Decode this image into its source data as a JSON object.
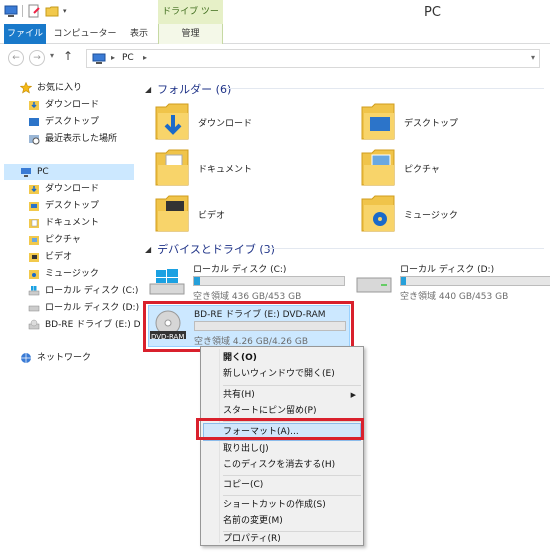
{
  "window": {
    "title": "PC",
    "context_tab_group": "ドライブ ツール"
  },
  "ribbon": {
    "tabs": [
      "ファイル",
      "コンピューター",
      "表示",
      "管理"
    ]
  },
  "address": {
    "path": "PC"
  },
  "navpane": {
    "favorites_label": "お気に入り",
    "favorites": [
      "ダウンロード",
      "デスクトップ",
      "最近表示した場所"
    ],
    "pc_label": "PC",
    "pc_items": [
      "ダウンロード",
      "デスクトップ",
      "ドキュメント",
      "ピクチャ",
      "ビデオ",
      "ミュージック",
      "ローカル ディスク (C:)",
      "ローカル ディスク (D:)",
      "BD-RE ドライブ (E:) D"
    ],
    "network_label": "ネットワーク"
  },
  "content": {
    "folders_header": "フォルダー (6)",
    "folders": [
      "ダウンロード",
      "デスクトップ",
      "ドキュメント",
      "ピクチャ",
      "ビデオ",
      "ミュージック"
    ],
    "drives_header": "デバイスとドライブ (3)",
    "drives": [
      {
        "name": "ローカル ディスク (C:)",
        "free": "空き領域 436 GB/453 GB",
        "used_fraction": 0.04
      },
      {
        "name": "ローカル ディスク (D:)",
        "free": "空き領域 440 GB/453 GB",
        "used_fraction": 0.03
      },
      {
        "name": "BD-RE ドライブ (E:) DVD-RAM",
        "free": "空き領域 4.26 GB/4.26 GB",
        "used_fraction": 0.0,
        "badge": "DVD-RAM"
      }
    ]
  },
  "context_menu": {
    "items": [
      {
        "label": "開く(O)",
        "bold": true
      },
      {
        "label": "新しいウィンドウで開く(E)"
      },
      {
        "label": "共有(H)",
        "submenu": true
      },
      {
        "label": "スタートにピン留め(P)"
      },
      {
        "label": "フォーマット(A)...",
        "highlighted": true
      },
      {
        "label": "取り出し(J)"
      },
      {
        "label": "このディスクを消去する(H)"
      },
      {
        "label": "コピー(C)"
      },
      {
        "label": "ショートカットの作成(S)"
      },
      {
        "label": "名前の変更(M)"
      },
      {
        "label": "プロパティ(R)"
      }
    ]
  },
  "colors": {
    "accent": "#1979ca",
    "highlight_box": "#d9202c",
    "selection": "#cce8ff",
    "drive_bar": "#26a0da"
  }
}
